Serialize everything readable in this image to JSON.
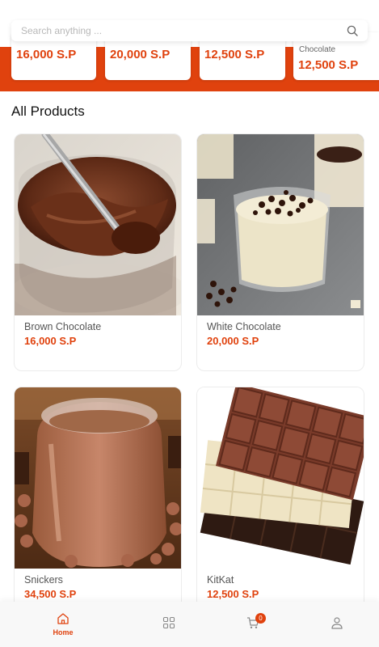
{
  "search": {
    "placeholder": "Search anything ..."
  },
  "featured": [
    {
      "name": "",
      "price": "16,000 S.P"
    },
    {
      "name": "",
      "price": "20,000 S.P"
    },
    {
      "name": "",
      "price": "12,500 S.P"
    },
    {
      "name": "Chocolate",
      "price": "12,500 S.P"
    }
  ],
  "section_title": "All Products",
  "products": [
    {
      "name": "Brown Chocolate",
      "price": "16,000 S.P",
      "image": "chocolate-spread-jar-image"
    },
    {
      "name": "White Chocolate",
      "price": "20,000 S.P",
      "image": "white-chocolate-dessert-image"
    },
    {
      "name": "Snickers",
      "price": "34,500 S.P",
      "image": "hazelnut-spread-jar-image"
    },
    {
      "name": "KitKat",
      "price": "12,500 S.P",
      "image": "chocolate-bars-image"
    }
  ],
  "nav": {
    "home_label": "Home",
    "cart_count": "0",
    "items": [
      "home-icon",
      "grid-icon",
      "cart-icon",
      "user-icon"
    ]
  },
  "colors": {
    "accent": "#e0420e",
    "background": "#ffffff",
    "nav_background": "#f8f8f8"
  }
}
